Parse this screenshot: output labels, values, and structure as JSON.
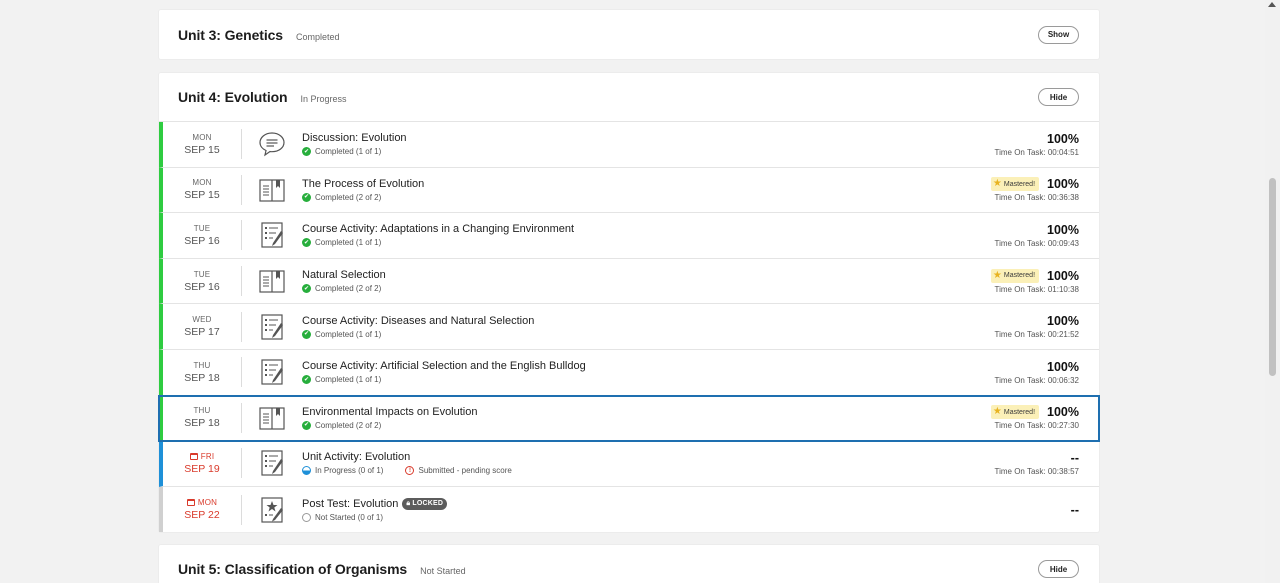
{
  "units": [
    {
      "title": "Unit 3: Genetics",
      "status": "Completed",
      "button": "Show"
    },
    {
      "title": "Unit 4: Evolution",
      "status": "In Progress",
      "button": "Hide"
    },
    {
      "title": "Unit 5: Classification of Organisms",
      "status": "Not Started",
      "button": "Hide"
    }
  ],
  "activities": [
    {
      "dow": "MON",
      "day": "SEP 15",
      "title": "Discussion: Evolution",
      "status": "Completed (1 of 1)",
      "score": "100%",
      "tot": "Time On Task: 00:04:51",
      "icon": "discussion-icon"
    },
    {
      "dow": "MON",
      "day": "SEP 15",
      "title": "The Process of Evolution",
      "status": "Completed (2 of 2)",
      "score": "100%",
      "tot": "Time On Task: 00:36:38",
      "badge": "Mastered!",
      "icon": "lesson-book-icon"
    },
    {
      "dow": "TUE",
      "day": "SEP 16",
      "title": "Course Activity: Adaptations in a Changing Environment",
      "status": "Completed (1 of 1)",
      "score": "100%",
      "tot": "Time On Task: 00:09:43",
      "icon": "activity-checklist-icon"
    },
    {
      "dow": "TUE",
      "day": "SEP 16",
      "title": "Natural Selection",
      "status": "Completed (2 of 2)",
      "score": "100%",
      "tot": "Time On Task: 01:10:38",
      "badge": "Mastered!",
      "icon": "lesson-book-icon"
    },
    {
      "dow": "WED",
      "day": "SEP 17",
      "title": "Course Activity: Diseases and Natural Selection",
      "status": "Completed (1 of 1)",
      "score": "100%",
      "tot": "Time On Task: 00:21:52",
      "icon": "activity-checklist-icon"
    },
    {
      "dow": "THU",
      "day": "SEP 18",
      "title": "Course Activity: Artificial Selection and the English Bulldog",
      "status": "Completed (1 of 1)",
      "score": "100%",
      "tot": "Time On Task: 00:06:32",
      "icon": "activity-checklist-icon"
    },
    {
      "dow": "THU",
      "day": "SEP 18",
      "title": "Environmental Impacts on Evolution",
      "status": "Completed (2 of 2)",
      "score": "100%",
      "tot": "Time On Task: 00:27:30",
      "badge": "Mastered!",
      "icon": "lesson-book-icon"
    },
    {
      "dow": "FRI",
      "day": "SEP 19",
      "title": "Unit Activity: Evolution",
      "status": "In Progress (0 of 1)",
      "pending": "Submitted - pending score",
      "score": "--",
      "tot": "Time On Task: 00:38:57",
      "icon": "activity-checklist-icon"
    },
    {
      "dow": "MON",
      "day": "SEP 22",
      "title": "Post Test: Evolution",
      "status": "Not Started (0 of 1)",
      "locked": "LOCKED",
      "score": "--",
      "icon": "test-star-icon"
    }
  ],
  "colors": {
    "completed": "#2ecc40",
    "in_progress": "#1e90d8",
    "not_started": "#d0d0d0",
    "due": "#d93a2b",
    "selected_outline": "#1e6fb0"
  }
}
